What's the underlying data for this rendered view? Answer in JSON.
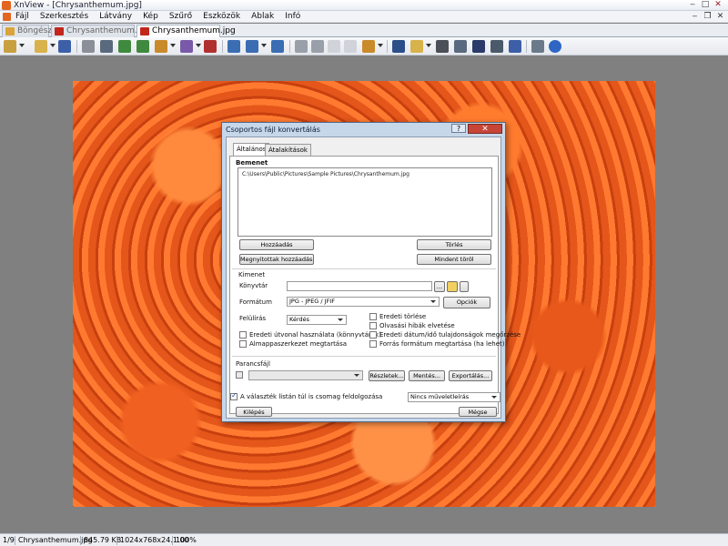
{
  "window": {
    "title": "XnView - [Chrysanthemum.jpg]",
    "minimize": "‒",
    "maximize": "□",
    "close": "✕"
  },
  "menu": {
    "items": [
      "Fájl",
      "Szerkesztés",
      "Látvány",
      "Kép",
      "Szűrő",
      "Eszközök",
      "Ablak",
      "Infó"
    ],
    "mdi_minimize": "‒",
    "mdi_restore": "❐",
    "mdi_close": "✕"
  },
  "tabs": [
    {
      "label": "Böngésző",
      "active": false
    },
    {
      "label": "Chrysanthemum.jpg",
      "active": false
    },
    {
      "label": "Chrysanthemum.jpg",
      "active": true
    }
  ],
  "dialog": {
    "title": "Csoportos fájl konvertálás",
    "help": "?",
    "close": "✕",
    "tabs": [
      "Általános",
      "Átalakítások"
    ],
    "input_heading": "Bemenet",
    "input_files": [
      "C:\\Users\\Public\\Pictures\\Sample Pictures\\Chrysanthemum.jpg"
    ],
    "buttons": {
      "add": "Hozzáadás",
      "remove": "Törlés",
      "add_open": "Megnyitottak hozzáadása",
      "remove_all": "Mindent töröl",
      "options": "Opciók",
      "details": "Részletek...",
      "save": "Mentés...",
      "export": "Exportálás...",
      "go": "Kilépés",
      "cancel": "Mégse",
      "browse": "..."
    },
    "output_heading": "Kimenet",
    "directory_label": "Könyvtár",
    "directory_value": "",
    "format_label": "Formátum",
    "format_value": "JPG - JPEG / JFIF",
    "overwrite_label": "Felülírás",
    "overwrite_value": "Kérdés",
    "checkboxes": [
      {
        "label": "Eredeti útvonal használata (könnyvtárak)",
        "checked": false
      },
      {
        "label": "Almappaszerkezet megtartása",
        "checked": false
      },
      {
        "label": "Eredeti törlése",
        "checked": false
      },
      {
        "label": "Olvasási hibák elvetése",
        "checked": false
      },
      {
        "label": "Eredeti dátum/idő tulajdonságok megőrzése",
        "checked": false
      },
      {
        "label": "Forrás formátum megtartása (ha lehet)",
        "checked": false
      }
    ],
    "script_heading": "Parancsfájl",
    "script_value": "",
    "bottom_checkbox": {
      "label": "A választék listán túl is csomag feldolgozása",
      "checked": true
    },
    "bottom_select": "Nincs műveletleírás"
  },
  "status": {
    "index": "1/9",
    "filename": "Chrysanthemum.jpg",
    "filesize": "845.79 KB",
    "dimensions": "1024x768x24.1.00",
    "zoom": "100%"
  }
}
